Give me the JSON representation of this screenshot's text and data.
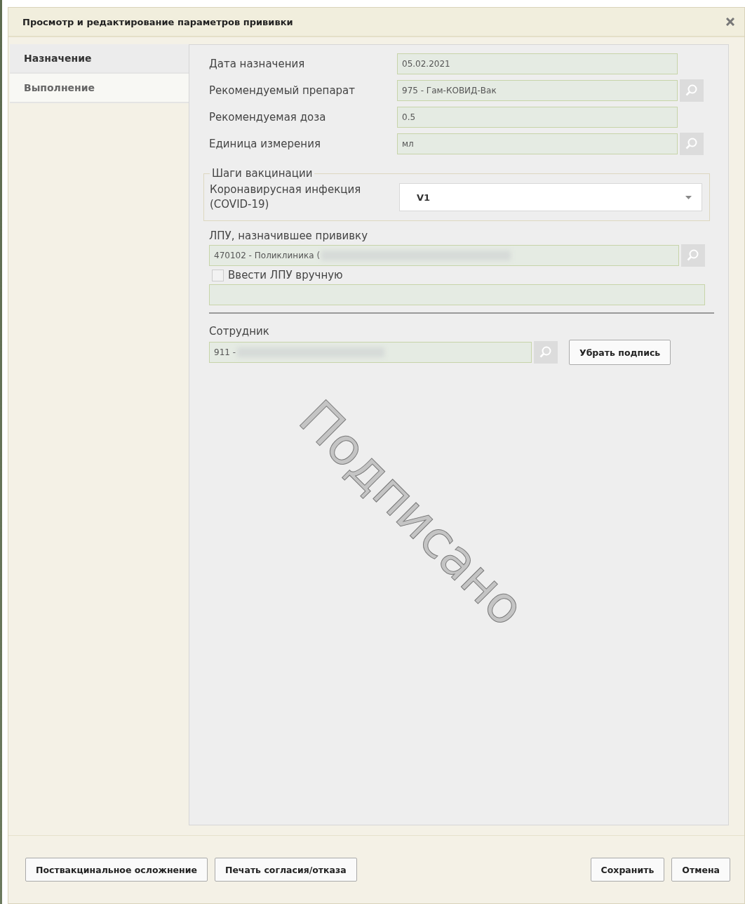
{
  "window": {
    "title": "Просмотр и редактирование параметров прививки"
  },
  "tabs": [
    {
      "label": "Назначение",
      "selected": true
    },
    {
      "label": "Выполнение",
      "selected": false
    }
  ],
  "fields": [
    {
      "label": "Дата назначения",
      "value": "05.02.2021",
      "kind": "text"
    },
    {
      "label": "Рекомендуемый препарат",
      "value": "975 - Гам-КОВИД-Вак",
      "kind": "lookup"
    },
    {
      "label": "Рекомендуемая доза",
      "value": "0.5",
      "kind": "text"
    },
    {
      "label": "Единица измерения",
      "value": "мл",
      "kind": "lookup"
    }
  ],
  "vaccination_steps": {
    "legend": "Шаги вакцинации",
    "rows": [
      {
        "label": "Коронавирусная инфекция (COVID-19)",
        "value": "V1"
      }
    ]
  },
  "lpu": {
    "label": "ЛПУ, назначившее прививку",
    "value": "470102 - Поликлиника (",
    "blurred": true
  },
  "manual_lpu": {
    "label": "Ввести ЛПУ вручную",
    "checked": false
  },
  "employee": {
    "label": "Сотрудник",
    "value": "911 -",
    "blurred": true,
    "button": "Убрать подпись"
  },
  "stamp": "Подписано",
  "footer": {
    "left_buttons": [
      "Поствакцинальное осложнение",
      "Печать согласия/отказа"
    ],
    "right_buttons": [
      "Сохранить",
      "Отмена"
    ]
  }
}
